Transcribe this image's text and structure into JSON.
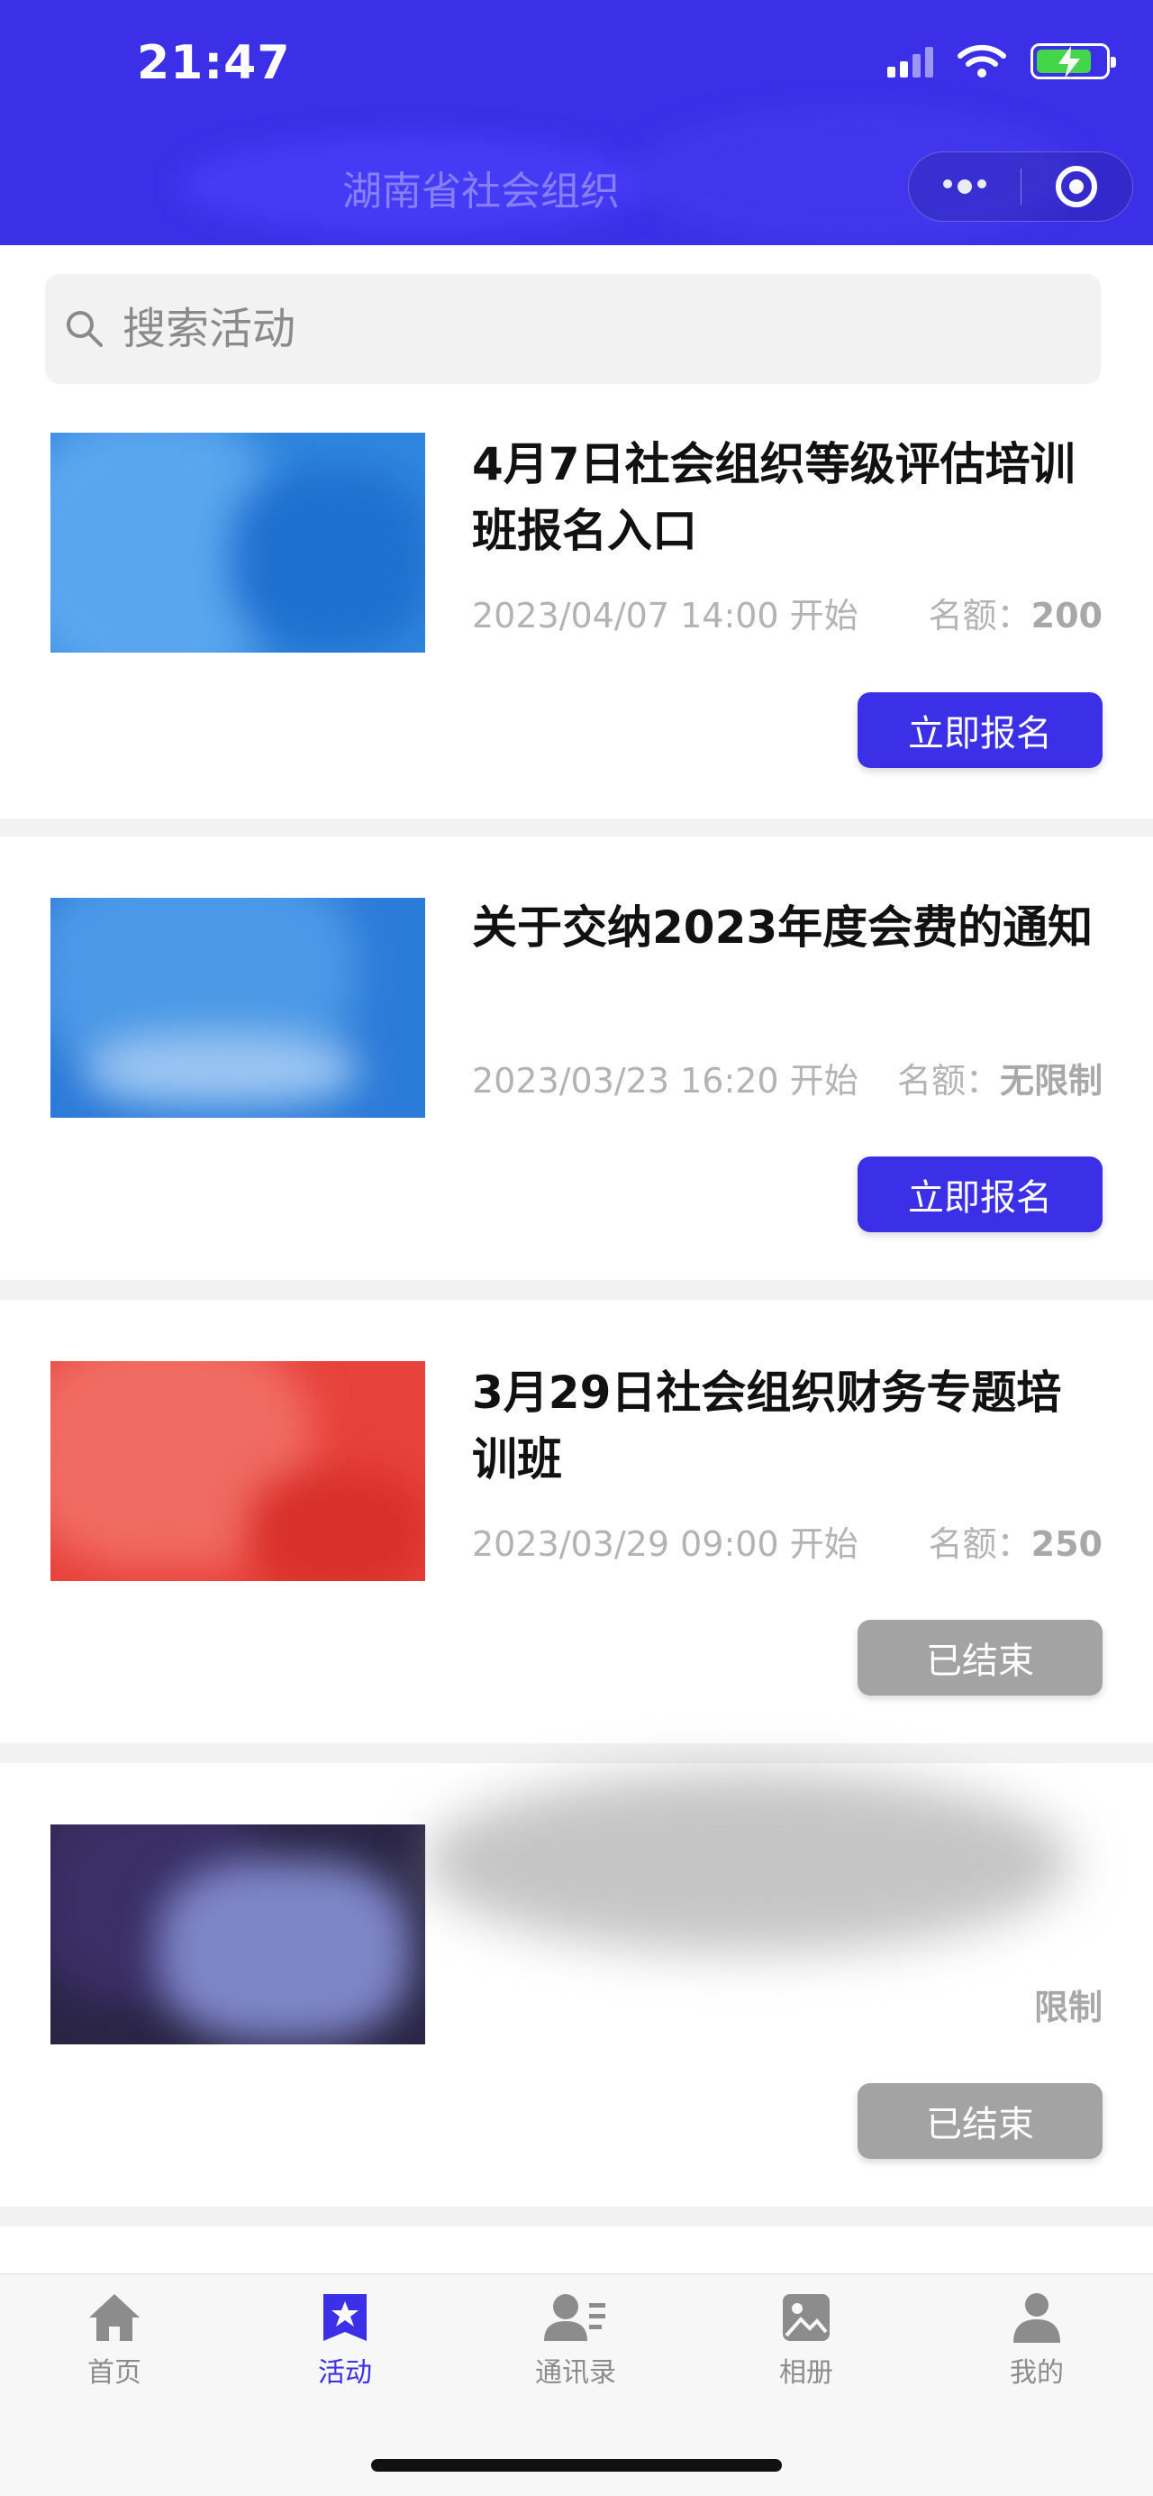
{
  "status_bar": {
    "time": "21:47"
  },
  "nav_bar": {
    "title": "湖南省社会组织"
  },
  "search": {
    "placeholder": "搜索活动"
  },
  "activities": [
    {
      "title": "4月7日社会组织等级评估培训班报名入口",
      "time": "2023/04/07 14:00 开始",
      "quota_label": "名额：",
      "quota_value": "200",
      "button": "立即报名",
      "status": "open"
    },
    {
      "title": "关于交纳2023年度会费的通知",
      "time": "2023/03/23 16:20 开始",
      "quota_label": "名额：",
      "quota_value": "无限制",
      "button": "立即报名",
      "status": "open"
    },
    {
      "title": "3月29日社会组织财务专题培训班",
      "time": "2023/03/29 09:00 开始",
      "quota_label": "名额：",
      "quota_value": "250",
      "button": "已结束",
      "status": "ended"
    },
    {
      "title": "",
      "time": "",
      "quota_label": "",
      "quota_value": "限制",
      "button": "已结束",
      "status": "ended"
    }
  ],
  "tabs": [
    {
      "label": "首页",
      "icon": "home-icon"
    },
    {
      "label": "活动",
      "icon": "activity-star-icon",
      "active": true
    },
    {
      "label": "通讯录",
      "icon": "contacts-icon"
    },
    {
      "label": "相册",
      "icon": "album-icon"
    },
    {
      "label": "我的",
      "icon": "profile-icon"
    }
  ],
  "colors": {
    "brand": "#3b2fe8",
    "ended_button": "#a3a3a3",
    "battery": "#43d64a"
  }
}
